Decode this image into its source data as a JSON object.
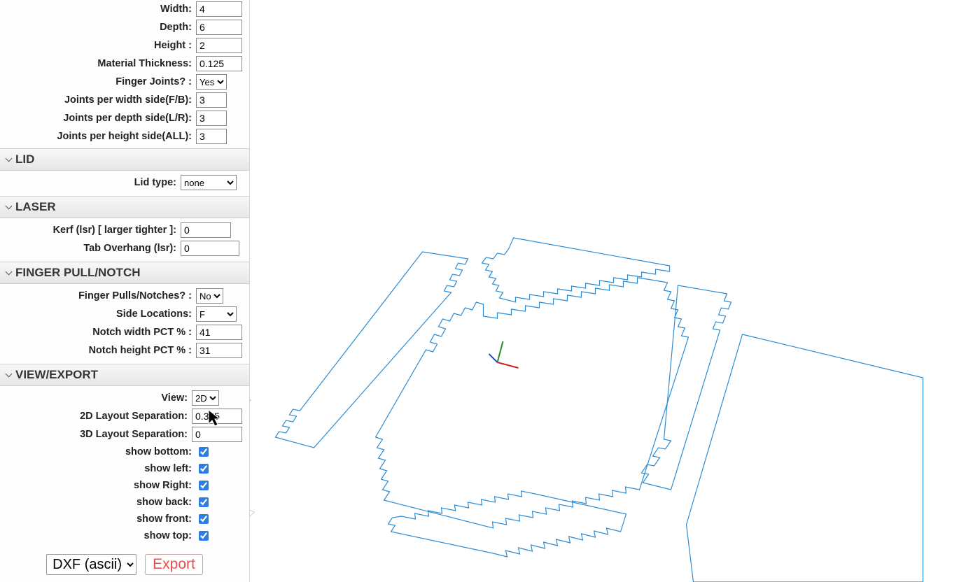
{
  "basic": {
    "width_label": "Width:",
    "width_value": "4",
    "depth_label": "Depth:",
    "depth_value": "6",
    "height_label": "Height :",
    "height_value": "2",
    "thickness_label": "Material Thickness:",
    "thickness_value": "0.125",
    "finger_joints_label": "Finger Joints? :",
    "finger_joints_value": "Yes",
    "joints_width_label": "Joints per width side(F/B):",
    "joints_width_value": "3",
    "joints_depth_label": "Joints per depth side(L/R):",
    "joints_depth_value": "3",
    "joints_height_label": "Joints per height side(ALL):",
    "joints_height_value": "3"
  },
  "lid": {
    "section_title": "LID",
    "type_label": "Lid type:",
    "type_value": "none"
  },
  "laser": {
    "section_title": "LASER",
    "kerf_label": "Kerf (lsr) [ larger tighter ]:",
    "kerf_value": "0",
    "tab_label": "Tab Overhang (lsr):",
    "tab_value": "0"
  },
  "notch": {
    "section_title": "FINGER PULL/NOTCH",
    "enable_label": "Finger Pulls/Notches? :",
    "enable_value": "No",
    "side_label": "Side Locations:",
    "side_value": "F",
    "width_pct_label": "Notch width PCT % :",
    "width_pct_value": "41",
    "height_pct_label": "Notch height PCT % :",
    "height_pct_value": "31"
  },
  "view": {
    "section_title": "VIEW/EXPORT",
    "view_label": "View:",
    "view_value": "2D",
    "sep2d_label": "2D Layout Separation:",
    "sep2d_value": "0.375",
    "sep3d_label": "3D Layout Separation:",
    "sep3d_value": "0",
    "show_bottom_label": "show bottom:",
    "show_bottom": true,
    "show_left_label": "show left:",
    "show_left": true,
    "show_right_label": "show Right:",
    "show_right": true,
    "show_back_label": "show back:",
    "show_back": true,
    "show_front_label": "show front:",
    "show_front": true,
    "show_top_label": "show top:",
    "show_top": true
  },
  "export": {
    "format": "DXF (ascii)",
    "button": "Export"
  }
}
